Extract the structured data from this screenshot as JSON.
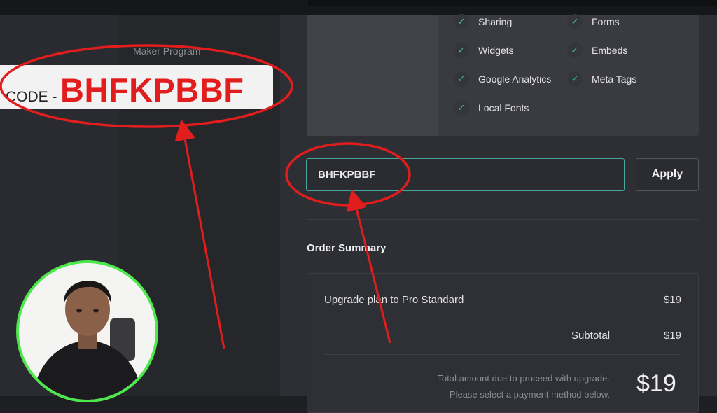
{
  "sidebar": {
    "items": [
      {
        "label": "Maker Program"
      }
    ]
  },
  "features": [
    {
      "label": "Sharing",
      "icon": "check-icon"
    },
    {
      "label": "Forms",
      "icon": "check-icon"
    },
    {
      "label": "Widgets",
      "icon": "check-icon"
    },
    {
      "label": "Embeds",
      "icon": "check-icon"
    },
    {
      "label": "Google Analytics",
      "icon": "check-icon"
    },
    {
      "label": "Meta Tags",
      "icon": "check-icon"
    },
    {
      "label": "Local Fonts",
      "icon": "check-icon"
    }
  ],
  "coupon": {
    "value": "BHFKPBBF",
    "apply_label": "Apply"
  },
  "order_summary": {
    "title": "Order Summary",
    "line_item_label": "Upgrade plan to Pro Standard",
    "line_item_value": "$19",
    "subtotal_label": "Subtotal",
    "subtotal_value": "$19",
    "note_line1": "Total amount due to proceed with upgrade.",
    "note_line2": "Please select a payment method below.",
    "total": "$19"
  },
  "overlay": {
    "code_prefix": "CODE -",
    "code_value": "BHFKPBBF"
  },
  "colors": {
    "accent": "#3fbf9b",
    "annotation": "#e21d1d",
    "webcam_ring": "#4de84b",
    "input_border": "#46a89b"
  }
}
